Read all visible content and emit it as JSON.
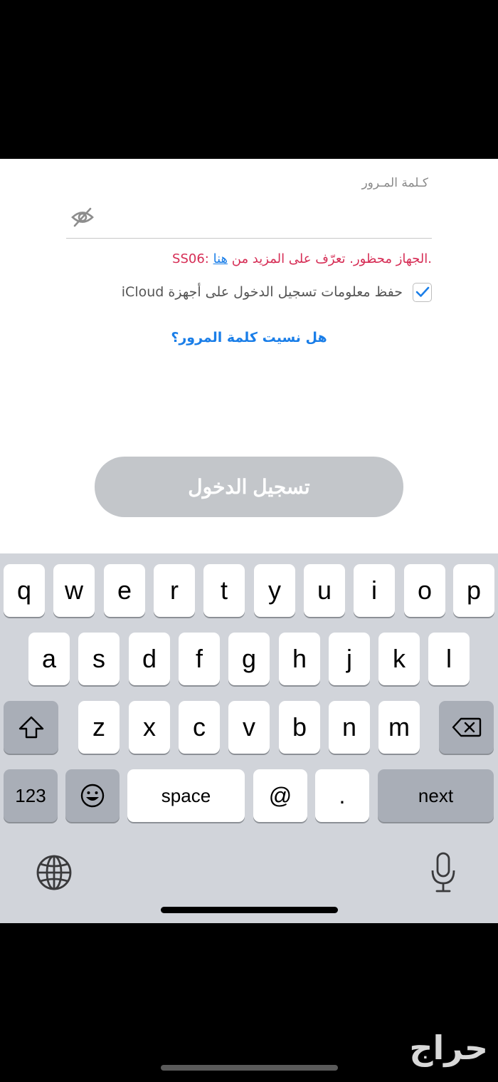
{
  "form": {
    "password_label": "كـلمة المـرور",
    "error_prefix": ".الجهاز محظور. تعرّف على المزيد من ",
    "error_link": "هنا",
    "error_code": " :SS06",
    "remember_label": "حفظ معلومات تسجيل الدخول على أجهزة iCloud",
    "remember_checked": true,
    "forgot_link": "هل نسيت كلمة المرور؟",
    "login_button": "تسجيل الدخول",
    "login_button_color": "#c3c6ca",
    "error_color": "#d62d55",
    "link_color": "#1a7ee8"
  },
  "keyboard": {
    "row1": [
      "q",
      "w",
      "e",
      "r",
      "t",
      "y",
      "u",
      "i",
      "o",
      "p"
    ],
    "row2": [
      "a",
      "s",
      "d",
      "f",
      "g",
      "h",
      "j",
      "k",
      "l"
    ],
    "row3": [
      "z",
      "x",
      "c",
      "v",
      "b",
      "n",
      "m"
    ],
    "numbers_label": "123",
    "space_label": "space",
    "at_label": "@",
    "dot_label": ".",
    "next_label": "next",
    "icons": {
      "shift": "shift-icon",
      "delete": "backspace-icon",
      "emoji": "emoji-icon",
      "globe": "globe-icon",
      "mic": "microphone-icon"
    }
  },
  "watermark": "حراج"
}
